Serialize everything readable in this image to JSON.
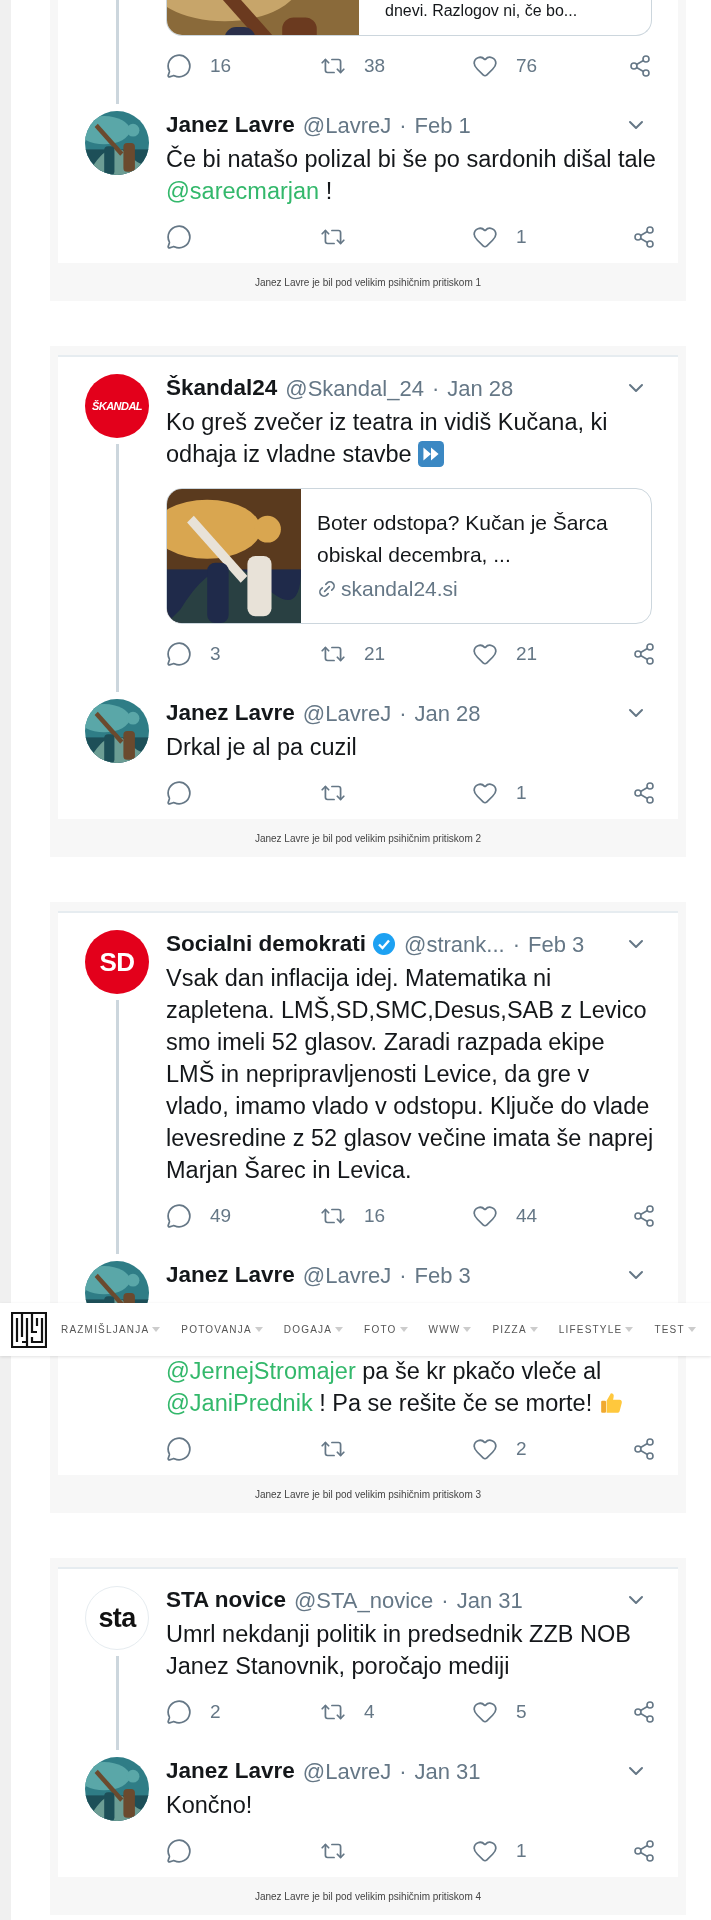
{
  "threads": [
    {
      "caption": "Janez Lavre je bil pod velikim psihičnim pritiskom 1",
      "original": {
        "kind": "link-card-tail",
        "link_card": {
          "title": "dnevi. Razlogov ni, če bo..."
        },
        "actions": {
          "replies": "16",
          "retweets": "38",
          "likes": "76"
        }
      },
      "reply": {
        "kind": "tweet",
        "name": "Janez Lavre",
        "verified": false,
        "handle": "@LavreJ",
        "separator": "·",
        "date": "Feb 1",
        "body": [
          {
            "kind": "text",
            "text": "Če bi natašo polizal bi še po sardonih dišal tale "
          },
          {
            "kind": "mention",
            "text": "@sarecmarjan"
          },
          {
            "kind": "text",
            "text": " !"
          }
        ],
        "actions": {
          "likes": "1"
        }
      }
    },
    {
      "caption": "Janez Lavre je bil pod velikim psihičnim pritiskom 2",
      "original": {
        "kind": "tweet",
        "name": "Škandal24",
        "verified": false,
        "handle": "@Skandal_24",
        "separator": "·",
        "date": "Jan 28",
        "avatar": {
          "kind": "red-logo",
          "text": "ŠKANDAL"
        },
        "body": [
          {
            "kind": "text",
            "text": "Ko greš zvečer iz teatra in vidiš Kučana, ki odhaja iz vladne stavbe "
          },
          {
            "kind": "fast-forward"
          }
        ],
        "link_card": {
          "title": "Boter odstopa? Kučan je Šarca obiskal decembra, ...",
          "domain": "skandal24.si"
        },
        "actions": {
          "replies": "3",
          "retweets": "21",
          "likes": "21"
        }
      },
      "reply": {
        "kind": "tweet",
        "name": "Janez Lavre",
        "verified": false,
        "handle": "@LavreJ",
        "separator": "·",
        "date": "Jan 28",
        "body": [
          {
            "kind": "text",
            "text": "Drkal je al pa cuzil"
          }
        ],
        "actions": {
          "likes": "1"
        }
      }
    },
    {
      "caption": "Janez Lavre je bil pod velikim psihičnim pritiskom 3",
      "original": {
        "kind": "tweet",
        "name": "Socialni demokrati",
        "verified": true,
        "handle": "@strank...",
        "separator": "·",
        "date": "Feb 3",
        "avatar": {
          "kind": "sd-logo",
          "text": "SD"
        },
        "body": [
          {
            "kind": "text",
            "text": "Vsak dan inflacija idej. Matematika ni zapletena. LMŠ,SD,SMC,Desus,SAB z Levico smo imeli 52 glasov. Zaradi razpada ekipe LMŠ in nepripravljenosti Levice, da gre v vlado, imamo vlado v odstopu. Ključe do vlade levesredine z 52 glasov večine imata še naprej Marjan Šarec in Levica."
          }
        ],
        "actions": {
          "replies": "49",
          "retweets": "16",
          "likes": "44"
        }
      },
      "reply": {
        "kind": "tweet",
        "name": "Janez Lavre",
        "verified": false,
        "handle": "@LavreJ",
        "separator": "·",
        "date": "Feb 3",
        "hidden_lines": true,
        "body": [
          {
            "kind": "mention",
            "text": "@JernejStromajer"
          },
          {
            "kind": "text",
            "text": " pa še kr pkačo vleče al "
          },
          {
            "kind": "mention",
            "text": "@JaniPrednik"
          },
          {
            "kind": "text",
            "text": " ! Pa se rešite če se morte! "
          },
          {
            "kind": "thumbs-up"
          }
        ],
        "actions": {
          "likes": "2"
        }
      }
    },
    {
      "caption": "Janez Lavre je bil pod velikim psihičnim pritiskom 4",
      "original": {
        "kind": "tweet",
        "name": "STA novice",
        "verified": false,
        "handle": "@STA_novice",
        "separator": "·",
        "date": "Jan 31",
        "avatar": {
          "kind": "sta-logo",
          "text": "sta"
        },
        "body": [
          {
            "kind": "text",
            "text": "Umrl nekdanji politik in predsednik ZZB NOB Janez Stanovnik, poročajo mediji"
          }
        ],
        "actions": {
          "replies": "2",
          "retweets": "4",
          "likes": "5"
        }
      },
      "reply": {
        "kind": "tweet",
        "name": "Janez Lavre",
        "verified": false,
        "handle": "@LavreJ",
        "separator": "·",
        "date": "Jan 31",
        "body": [
          {
            "kind": "text",
            "text": "Končno!"
          }
        ],
        "actions": {
          "likes": "1"
        }
      }
    }
  ],
  "nav": {
    "items": [
      {
        "label": "RAZMIŠLJANJA"
      },
      {
        "label": "POTOVANJA"
      },
      {
        "label": "DOGAJA"
      },
      {
        "label": "FOTO"
      },
      {
        "label": "WWW"
      },
      {
        "label": "PIZZA"
      },
      {
        "label": "LIFESTYLE"
      },
      {
        "label": "TEST"
      }
    ]
  }
}
